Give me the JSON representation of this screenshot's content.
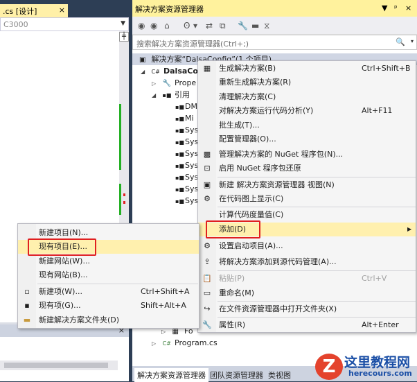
{
  "left": {
    "doc_tab": ".cs [设计]",
    "doc_tab_close": "×",
    "combo_value": "C3000",
    "combo_arrow": "▼",
    "split_btn": "╪",
    "bottom_close": "×"
  },
  "solution_explorer": {
    "title": "解决方案资源管理器",
    "title_buttons": [
      "▼",
      "ᵖ",
      "×"
    ],
    "toolbar_icons": [
      "◉",
      "◉",
      "⌂",
      "ʘ",
      "▾",
      "⇄",
      "⧉",
      "🔧",
      "▬",
      "⧖"
    ],
    "search_placeholder": "搜索解决方案资源管理器(Ctrl+;)",
    "search_icon": "🔍",
    "search_arrow": "▾",
    "tree": [
      {
        "label": "解决方案“DalsaConfig”(1 个项目)",
        "icon": "solution-icon",
        "glyph": "▣"
      },
      {
        "label": "DalsaCo",
        "icon": "csharp-project-icon",
        "glyph": "C#"
      },
      {
        "label": "Prope",
        "icon": "wrench-icon",
        "glyph": "🔧"
      },
      {
        "label": "引用",
        "icon": "references-icon",
        "glyph": "▪■"
      },
      {
        "label": "DM",
        "icon": "reference-icon",
        "glyph": "▪■"
      },
      {
        "label": "Mi",
        "icon": "reference-icon",
        "glyph": "▪■"
      },
      {
        "label": "Sys",
        "icon": "reference-icon",
        "glyph": "▪■"
      },
      {
        "label": "Sys",
        "icon": "reference-icon",
        "glyph": "▪■"
      },
      {
        "label": "Sys",
        "icon": "reference-icon",
        "glyph": "▪■"
      },
      {
        "label": "Sys",
        "icon": "reference-icon",
        "glyph": "▪■"
      },
      {
        "label": "Sys",
        "icon": "reference-icon",
        "glyph": "▪■"
      },
      {
        "label": "Sys",
        "icon": "reference-icon",
        "glyph": "▪■"
      },
      {
        "label": "Sys",
        "icon": "reference-icon",
        "glyph": "▪■"
      },
      {
        "label": "Fo",
        "icon": "form-icon",
        "glyph": "▦"
      },
      {
        "label": "Program.cs",
        "icon": "csharp-file-icon",
        "glyph": "C#"
      }
    ],
    "bottom_tabs": [
      "解决方案资源管理器",
      "团队资源管理器",
      "类视图"
    ]
  },
  "main_menu": [
    {
      "label": "生成解决方案(B)",
      "shortcut": "Ctrl+Shift+B",
      "icon": "build-icon",
      "glyph": "▦"
    },
    {
      "label": "重新生成解决方案(R)",
      "shortcut": "",
      "icon": "",
      "glyph": ""
    },
    {
      "label": "清理解决方案(C)",
      "shortcut": "",
      "icon": "",
      "glyph": ""
    },
    {
      "label": "对解决方案运行代码分析(Y)",
      "shortcut": "Alt+F11",
      "icon": "",
      "glyph": ""
    },
    {
      "label": "批生成(T)...",
      "shortcut": "",
      "icon": "",
      "glyph": ""
    },
    {
      "label": "配置管理器(O)...",
      "shortcut": "",
      "icon": "",
      "glyph": ""
    },
    {
      "label": "管理解决方案的 NuGet 程序包(N)...",
      "shortcut": "",
      "icon": "nuget-icon",
      "glyph": "▩"
    },
    {
      "label": "启用 NuGet 程序包还原",
      "shortcut": "",
      "icon": "nuget-restore-icon",
      "glyph": "⊡"
    },
    {
      "label": "新建 解决方案资源管理器 视图(N)",
      "shortcut": "",
      "icon": "new-view-icon",
      "glyph": "▣"
    },
    {
      "label": "在代码图上显示(C)",
      "shortcut": "",
      "icon": "code-map-icon",
      "glyph": "⚙"
    },
    {
      "label": "计算代码度量值(C)",
      "shortcut": "",
      "icon": "",
      "glyph": ""
    },
    {
      "label": "添加(D)",
      "shortcut": "",
      "icon": "",
      "glyph": "",
      "submenu_arrow": "▶"
    },
    {
      "label": "设置启动项目(A)...",
      "shortcut": "",
      "icon": "gear-icon",
      "glyph": "⚙"
    },
    {
      "label": "将解决方案添加到源代码管理(A)...",
      "shortcut": "",
      "icon": "source-control-icon",
      "glyph": "⇪"
    },
    {
      "label": "粘贴(P)",
      "shortcut": "Ctrl+V",
      "icon": "paste-icon",
      "glyph": "📋"
    },
    {
      "label": "重命名(M)",
      "shortcut": "",
      "icon": "rename-icon",
      "glyph": "▭"
    },
    {
      "label": "在文件资源管理器中打开文件夹(X)",
      "shortcut": "",
      "icon": "open-folder-icon",
      "glyph": "↪"
    },
    {
      "label": "属性(R)",
      "shortcut": "Alt+Enter",
      "icon": "wrench-icon",
      "glyph": "🔧"
    }
  ],
  "sub_menu": [
    {
      "label": "新建项目(N)...",
      "shortcut": "",
      "icon": "",
      "glyph": ""
    },
    {
      "label": "现有项目(E)...",
      "shortcut": "",
      "icon": "",
      "glyph": ""
    },
    {
      "label": "新建网站(W)...",
      "shortcut": "",
      "icon": "",
      "glyph": ""
    },
    {
      "label": "现有网站(B)...",
      "shortcut": "",
      "icon": "",
      "glyph": ""
    },
    {
      "label": "新建项(W)...",
      "shortcut": "Ctrl+Shift+A",
      "icon": "new-item-icon",
      "glyph": "▫"
    },
    {
      "label": "现有项(G)...",
      "shortcut": "Shift+Alt+A",
      "icon": "existing-item-icon",
      "glyph": "▪"
    },
    {
      "label": "新建解决方案文件夹(D)",
      "shortcut": "",
      "icon": "folder-icon",
      "glyph": "▬"
    }
  ],
  "watermark": {
    "logo": "Z",
    "title": "这里教程网",
    "url": "herecours.com"
  },
  "colors": {
    "highlight": "#fff0ae",
    "title_bar": "#fff29d",
    "red_callout": "#e02020",
    "frame": "#2d3e55"
  }
}
